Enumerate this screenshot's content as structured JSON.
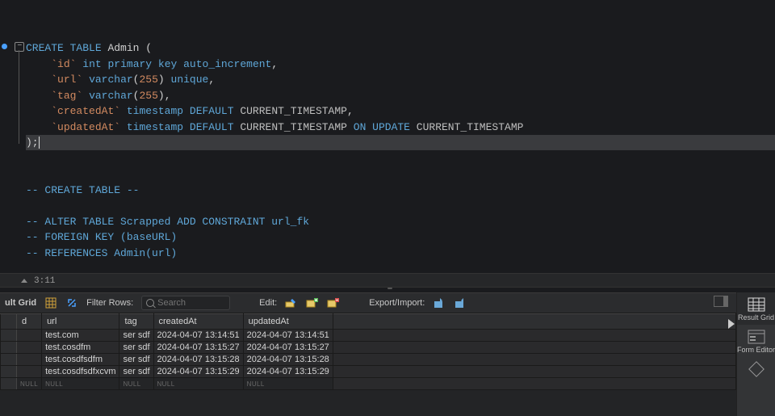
{
  "editor": {
    "tokens": {
      "create": "CREATE",
      "table": "TABLE",
      "admin": "Admin",
      "id": "id",
      "url": "url",
      "tag": "tag",
      "createdAt": "createdAt",
      "updatedAt": "updatedAt",
      "int": "int",
      "primarykey": "primary key",
      "autoinc": "auto_increment",
      "varchar": "varchar",
      "n255a": "255",
      "n255b": "255",
      "unique": "unique",
      "timestamp": "timestamp",
      "default": "DEFAULT",
      "curts1": "CURRENT_TIMESTAMP",
      "curts2": "CURRENT_TIMESTAMP",
      "onupdate": "ON UPDATE",
      "curts3": "CURRENT_TIMESTAMP"
    },
    "comments": {
      "c1": "-- CREATE TABLE --",
      "c2": "-- ALTER TABLE Scrapped ADD CONSTRAINT url_fk",
      "c3": "-- FOREIGN KEY (baseURL)",
      "c4": "-- REFERENCES Admin(url)"
    }
  },
  "status": {
    "pos": "3:11"
  },
  "toolbar": {
    "grid_label": "ult Grid",
    "filter_label": "Filter Rows:",
    "search_placeholder": "Search",
    "edit_label": "Edit:",
    "export_label": "Export/Import:"
  },
  "columns": [
    "d",
    "url",
    "tag",
    "createdAt",
    "updatedAt"
  ],
  "rows": [
    {
      "d": "",
      "url": "test.com",
      "tag": "ser sdf",
      "createdAt": "2024-04-07 13:14:51",
      "updatedAt": "2024-04-07 13:14:51"
    },
    {
      "d": "",
      "url": "test.cosdfm",
      "tag": "ser sdf",
      "createdAt": "2024-04-07 13:15:27",
      "updatedAt": "2024-04-07 13:15:27"
    },
    {
      "d": "",
      "url": "test.cosdfsdfm",
      "tag": "ser sdf",
      "createdAt": "2024-04-07 13:15:28",
      "updatedAt": "2024-04-07 13:15:28"
    },
    {
      "d": "",
      "url": "test.cosdfsdfxcvm",
      "tag": "ser sdf",
      "createdAt": "2024-04-07 13:15:29",
      "updatedAt": "2024-04-07 13:15:29"
    }
  ],
  "null_label": "NULL",
  "right_panel": {
    "result_grid": "Result Grid",
    "form_editor": "Form Editor"
  }
}
